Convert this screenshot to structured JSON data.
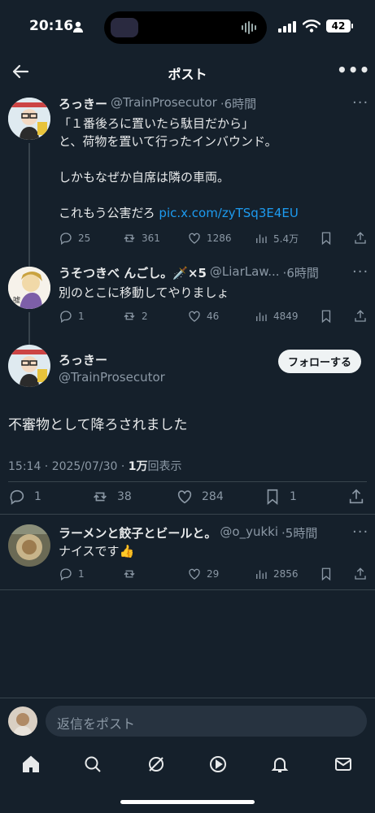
{
  "status": {
    "time": "20:16",
    "battery": "42"
  },
  "header": {
    "title": "ポスト"
  },
  "tweets": [
    {
      "name": "ろっきー",
      "handle": "@TrainProsecutor",
      "time": "·6時間",
      "text": "「１番後ろに置いたら駄目だから」\nと、荷物を置いて行ったインバウンド。\n\nしかもなぜか自席は隣の車両。\n\nこれもう公害だろ ",
      "link": "pic.x.com/zyTSq3E4EU",
      "replies": "25",
      "reposts": "361",
      "likes": "1286",
      "views": "5.4万"
    },
    {
      "name": "うそつきべ んごし。🗡️×5",
      "handle": "@LiarLaw...",
      "time": "·6時間",
      "text": "別のとこに移動してやりましょ",
      "replies": "1",
      "reposts": "2",
      "likes": "46",
      "views": "4849"
    }
  ],
  "main": {
    "name": "ろっきー",
    "handle": "@TrainProsecutor",
    "follow_label": "フォローする",
    "text": "不審物として降ろされました",
    "meta_time": "15:14 · 2025/07/30 · ",
    "meta_views": "1万",
    "meta_suffix": "回表示",
    "replies": "1",
    "reposts": "38",
    "likes": "284",
    "bookmarks": "1"
  },
  "reply": {
    "name": "ラーメンと餃子とビールと。",
    "handle": "@o_yukki",
    "time": "·5時間",
    "text": "ナイスです👍",
    "replies": "1",
    "likes": "29",
    "views": "2856"
  },
  "composer": {
    "placeholder": "返信をポスト"
  },
  "colors": {
    "background": "#15202b",
    "accent": "#1d9bf0",
    "muted": "#8b98a5",
    "divider": "#38444d"
  },
  "tabs": [
    "home-icon",
    "search-icon",
    "grok-icon",
    "video-icon",
    "notifications-icon",
    "messages-icon"
  ]
}
